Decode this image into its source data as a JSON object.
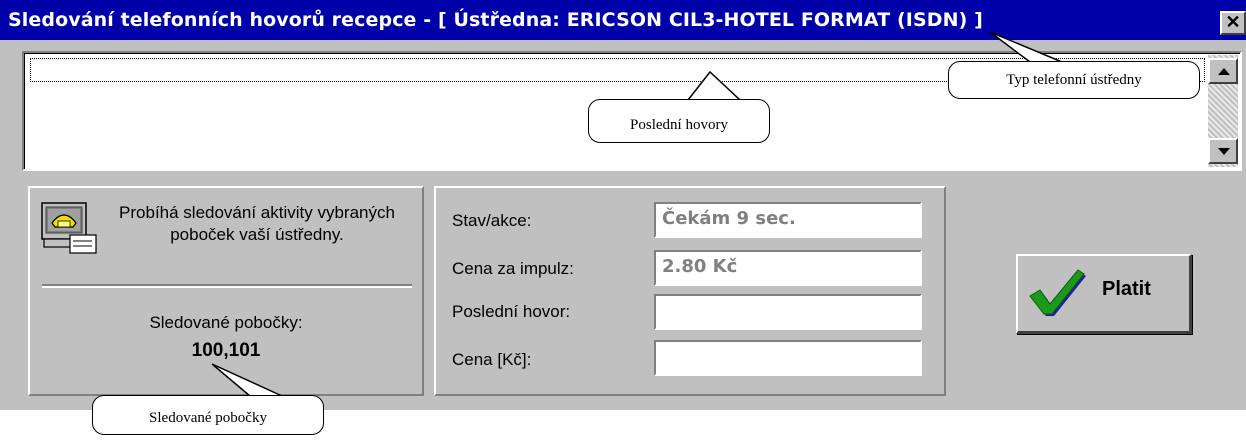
{
  "window": {
    "title": "Sledování telefonních hovorů recepce - [ Ústředna: ERICSON CIL3-HOTEL FORMAT (ISDN) ]",
    "close_glyph": "✕"
  },
  "status_panel": {
    "info_text": "Probíhá sledování aktivity vybraných poboček vaší ústředny.",
    "monitored_label": "Sledované pobočky:",
    "monitored_value": "100,101",
    "icon": "telephone-computer-icon"
  },
  "fields": [
    {
      "label": "Stav/akce:",
      "value": "Čekám 9 sec."
    },
    {
      "label": "Cena za impulz:",
      "value": "2.80 Kč"
    },
    {
      "label": "Poslední hovor:",
      "value": ""
    },
    {
      "label": "Cena [Kč]:",
      "value": ""
    }
  ],
  "pay_button": {
    "label": "Platit",
    "icon": "checkmark-icon"
  },
  "callouts": {
    "switchboard_type": "Typ telefonní ústředny",
    "last_calls": "Poslední hovory",
    "monitored_branches": "Sledované pobočky"
  },
  "colors": {
    "titlebar": "#0000a8",
    "face": "#c0c0c0",
    "check_green": "#1a9a1a",
    "check_shadow": "#2020a0"
  }
}
